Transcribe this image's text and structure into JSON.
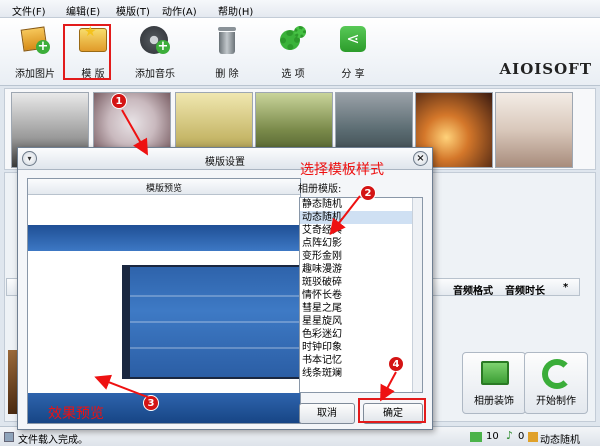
{
  "menu": [
    "文件(F)",
    "编辑(E)",
    "模版(T)",
    "动作(A)",
    "帮助(H)"
  ],
  "toolbar": {
    "add_image": "添加图片",
    "template": "模 版",
    "add_music": "添加音乐",
    "delete": "删 除",
    "options": "选 项",
    "share": "分 享"
  },
  "logo": "AIOISOFT",
  "table": {
    "audio_format": "音频格式",
    "audio_duration": "音频时长",
    "star": "*"
  },
  "bottom_buttons": {
    "album_decor": "相册装饰",
    "start_make": "开始制作"
  },
  "status": {
    "text": "文件载入完成。",
    "count_images": "10",
    "count_music": "0",
    "mode": "动态随机"
  },
  "dialog": {
    "title": "模版设置",
    "preview_header": "模版预览",
    "album_label": "相册模版:",
    "templates": [
      "静态随机",
      "动态随机",
      "艾奇经典",
      "点阵幻影",
      "变形金刚",
      "趣味漫游",
      "斑驳破碎",
      "情怀长卷",
      "彗星之尾",
      "星星旋风",
      "色彩迷幻",
      "时钟印象",
      "书本记忆",
      "线条斑斓"
    ],
    "selected_index": 1,
    "cancel": "取消",
    "ok": "确定"
  },
  "annotations": {
    "select_style": "选择模板样式",
    "preview_effect": "效果预览",
    "n1": "1",
    "n2": "2",
    "n3": "3",
    "n4": "4"
  },
  "colors": {
    "accent_red": "#e11",
    "preview_blue": "#2e63ab"
  }
}
